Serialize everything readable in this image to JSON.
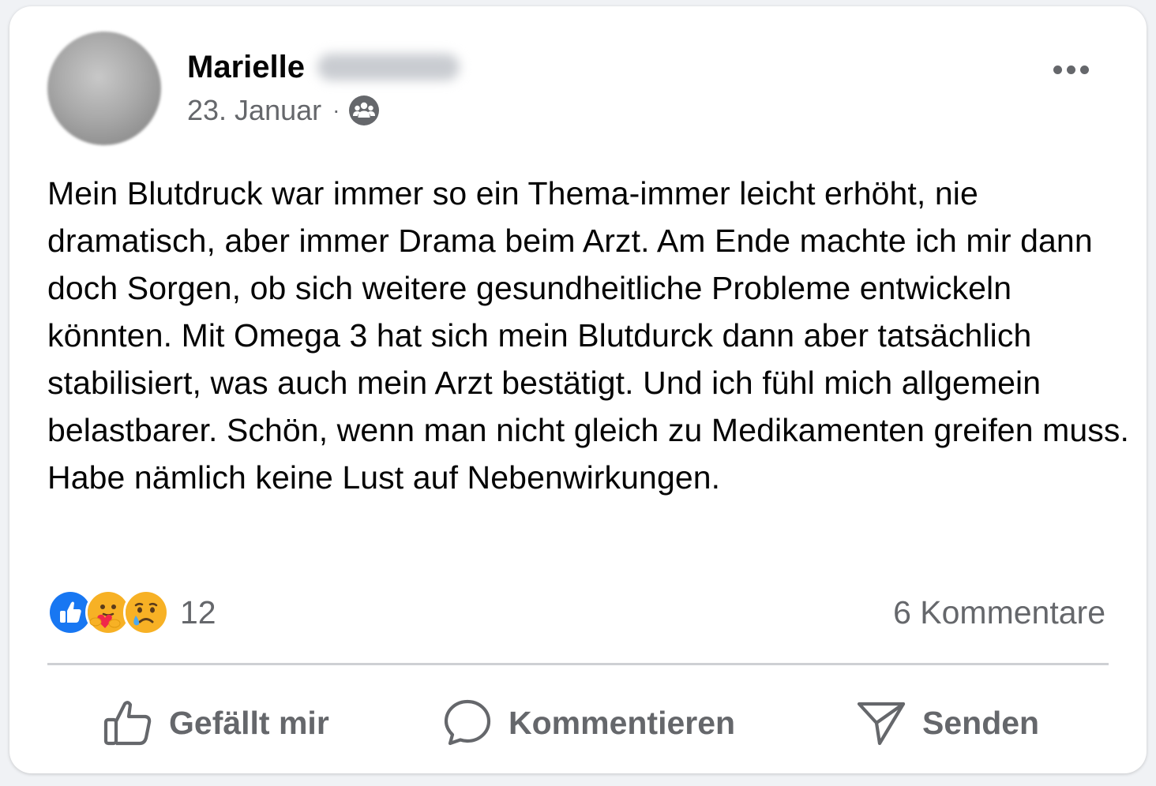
{
  "post": {
    "author_first_name": "Marielle",
    "date": "23. Januar",
    "separator": "·",
    "audience_icon": "group-audience-icon",
    "more_icon": "more-options-icon",
    "text": "Mein Blutdruck war immer so ein Thema-immer leicht erhöht, nie dramatisch, aber immer Drama beim Arzt. Am Ende machte ich mir dann doch Sorgen, ob sich weitere gesundheitliche Probleme entwickeln könnten. Mit Omega 3 hat sich mein Blutdurck dann aber tatsächlich stabilisiert, was auch mein Arzt bestätigt. Und ich fühl mich allgemein belastbarer. Schön, wenn man nicht gleich zu Medikamenten greifen muss. Habe nämlich keine Lust auf Nebenwirkungen."
  },
  "engagement": {
    "reaction_icons": [
      "like-reaction-icon",
      "care-reaction-icon",
      "sad-reaction-icon"
    ],
    "reaction_count": "12",
    "comments_label": "6 Kommentare"
  },
  "actions": {
    "like_label": "Gefällt mir",
    "comment_label": "Kommentieren",
    "send_label": "Senden"
  },
  "colors": {
    "text_primary": "#050505",
    "text_secondary": "#65676b",
    "like_blue": "#1877f2",
    "reaction_yellow": "#f7b125",
    "divider": "#ced0d4"
  }
}
